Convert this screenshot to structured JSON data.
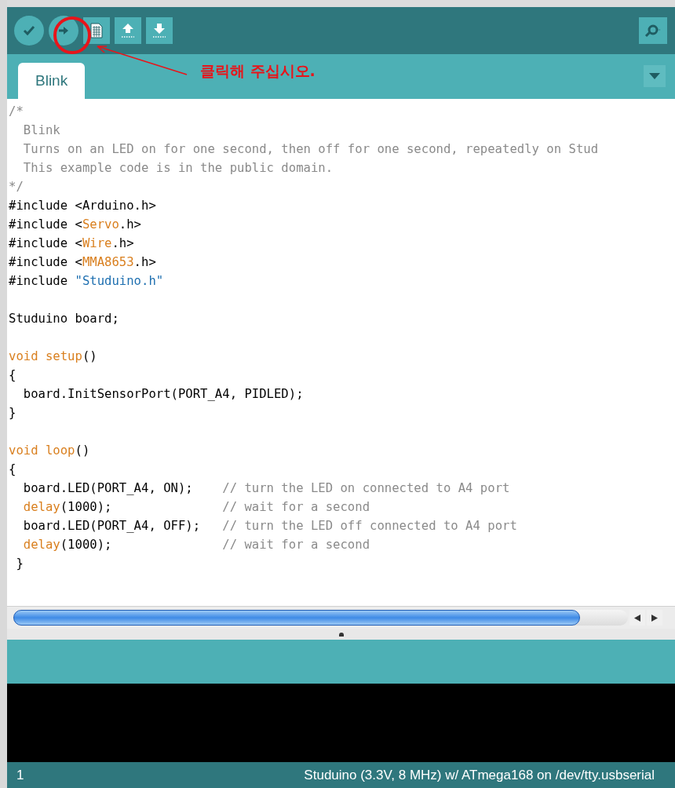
{
  "toolbar": {
    "buttons": [
      {
        "kind": "round"
      },
      {
        "kind": "round"
      },
      {
        "kind": "square"
      },
      {
        "kind": "square"
      },
      {
        "kind": "square"
      }
    ]
  },
  "annotation": {
    "text": "클릭해 주십시오."
  },
  "tabs": [
    {
      "label": "Blink",
      "selected": true
    }
  ],
  "editor": {
    "lines": [
      {
        "kind": "code",
        "segments": [
          {
            "kind": "comment",
            "text": "/*"
          }
        ]
      },
      {
        "kind": "code",
        "segments": [
          {
            "kind": "comment",
            "text": "  Blink"
          }
        ]
      },
      {
        "kind": "code",
        "segments": [
          {
            "kind": "comment",
            "text": "  Turns on an LED on for one second, then off for one second, repeatedly on Stud"
          }
        ]
      },
      {
        "kind": "code",
        "segments": [
          {
            "kind": "comment",
            "text": "  This example code is in the public domain."
          }
        ]
      },
      {
        "kind": "code",
        "segments": [
          {
            "kind": "comment",
            "text": "*/"
          }
        ]
      },
      {
        "kind": "code",
        "segments": [
          {
            "kind": "plain",
            "text": "#include <Arduino.h>"
          }
        ]
      },
      {
        "kind": "code",
        "segments": [
          {
            "kind": "plain",
            "text": "#include <"
          },
          {
            "kind": "keyword",
            "text": "Servo"
          },
          {
            "kind": "plain",
            "text": ".h>"
          }
        ]
      },
      {
        "kind": "code",
        "segments": [
          {
            "kind": "plain",
            "text": "#include <"
          },
          {
            "kind": "keyword",
            "text": "Wire"
          },
          {
            "kind": "plain",
            "text": ".h>"
          }
        ]
      },
      {
        "kind": "code",
        "segments": [
          {
            "kind": "plain",
            "text": "#include <"
          },
          {
            "kind": "keyword",
            "text": "MMA8653"
          },
          {
            "kind": "plain",
            "text": ".h>"
          }
        ]
      },
      {
        "kind": "code",
        "segments": [
          {
            "kind": "plain",
            "text": "#include "
          },
          {
            "kind": "string",
            "text": "\"Studuino.h\""
          }
        ]
      },
      {
        "kind": "blank"
      },
      {
        "kind": "code",
        "segments": [
          {
            "kind": "plain",
            "text": "Studuino board;"
          }
        ]
      },
      {
        "kind": "blank"
      },
      {
        "kind": "code",
        "segments": [
          {
            "kind": "keyword",
            "text": "void setup"
          },
          {
            "kind": "plain",
            "text": "()"
          }
        ]
      },
      {
        "kind": "code",
        "segments": [
          {
            "kind": "plain",
            "text": "{"
          }
        ]
      },
      {
        "kind": "code",
        "segments": [
          {
            "kind": "plain",
            "text": "  board.InitSensorPort(PORT_A4, PIDLED);"
          }
        ]
      },
      {
        "kind": "code",
        "segments": [
          {
            "kind": "plain",
            "text": "}"
          }
        ]
      },
      {
        "kind": "blank"
      },
      {
        "kind": "code",
        "segments": [
          {
            "kind": "keyword",
            "text": "void loop"
          },
          {
            "kind": "plain",
            "text": "()"
          }
        ]
      },
      {
        "kind": "code",
        "segments": [
          {
            "kind": "plain",
            "text": "{"
          }
        ]
      },
      {
        "kind": "code",
        "segments": [
          {
            "kind": "plain",
            "text": "  board.LED(PORT_A4, ON);    "
          },
          {
            "kind": "comment",
            "text": "// turn the LED on connected to A4 port"
          }
        ]
      },
      {
        "kind": "code",
        "segments": [
          {
            "kind": "keyword",
            "text": "  delay"
          },
          {
            "kind": "plain",
            "text": "(1000);               "
          },
          {
            "kind": "comment",
            "text": "// wait for a second"
          }
        ]
      },
      {
        "kind": "code",
        "segments": [
          {
            "kind": "plain",
            "text": "  board.LED(PORT_A4, OFF);   "
          },
          {
            "kind": "comment",
            "text": "// turn the LED off connected to A4 port"
          }
        ]
      },
      {
        "kind": "code",
        "segments": [
          {
            "kind": "keyword",
            "text": "  delay"
          },
          {
            "kind": "plain",
            "text": "(1000);               "
          },
          {
            "kind": "comment",
            "text": "// wait for a second"
          }
        ]
      },
      {
        "kind": "code",
        "segments": [
          {
            "kind": "plain",
            "text": " }"
          }
        ]
      }
    ]
  },
  "status_bar": {
    "line": "1",
    "board": "Studuino (3.3V, 8 MHz) w/ ATmega168 on /dev/tty.usbserial"
  }
}
